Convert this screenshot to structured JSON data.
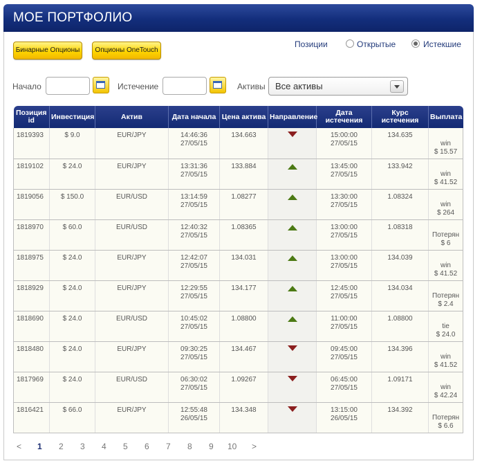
{
  "header": {
    "title": "МОЕ ПОРТФОЛИО"
  },
  "buttons": {
    "binary": "Бинарные Опционы",
    "onetouch": "Опционы OneTouch"
  },
  "positions": {
    "label": "Позиции",
    "open": "Открытые",
    "expired": "Истекшие",
    "selected": "expired"
  },
  "filters": {
    "start_label": "Начало",
    "start_value": "",
    "expiry_label": "Истечение",
    "expiry_value": "",
    "assets_label": "Активы",
    "assets_value": "Все активы"
  },
  "table": {
    "headers": [
      "Позиция id",
      "Инвестиция",
      "Актив",
      "Дата начала",
      "Цена актива",
      "Направление",
      "Дата истечения",
      "Курс истечения",
      "Выплата"
    ],
    "rows": [
      {
        "id": "1819393",
        "inv": "$ 9.0",
        "asset": "EUR/JPY",
        "st": "14:46:36",
        "sd": "27/05/15",
        "price": "134.663",
        "dir": "down",
        "et": "15:00:00",
        "ed": "27/05/15",
        "rate": "134.635",
        "r1": "win",
        "r2": "$ 15.57"
      },
      {
        "id": "1819102",
        "inv": "$ 24.0",
        "asset": "EUR/JPY",
        "st": "13:31:36",
        "sd": "27/05/15",
        "price": "133.884",
        "dir": "up",
        "et": "13:45:00",
        "ed": "27/05/15",
        "rate": "133.942",
        "r1": "win",
        "r2": "$ 41.52"
      },
      {
        "id": "1819056",
        "inv": "$ 150.0",
        "asset": "EUR/USD",
        "st": "13:14:59",
        "sd": "27/05/15",
        "price": "1.08277",
        "dir": "up",
        "et": "13:30:00",
        "ed": "27/05/15",
        "rate": "1.08324",
        "r1": "win",
        "r2": "$ 264"
      },
      {
        "id": "1818970",
        "inv": "$ 60.0",
        "asset": "EUR/USD",
        "st": "12:40:32",
        "sd": "27/05/15",
        "price": "1.08365",
        "dir": "up",
        "et": "13:00:00",
        "ed": "27/05/15",
        "rate": "1.08318",
        "r1": "Потерян",
        "r2": "$ 6"
      },
      {
        "id": "1818975",
        "inv": "$ 24.0",
        "asset": "EUR/JPY",
        "st": "12:42:07",
        "sd": "27/05/15",
        "price": "134.031",
        "dir": "up",
        "et": "13:00:00",
        "ed": "27/05/15",
        "rate": "134.039",
        "r1": "win",
        "r2": "$ 41.52"
      },
      {
        "id": "1818929",
        "inv": "$ 24.0",
        "asset": "EUR/JPY",
        "st": "12:29:55",
        "sd": "27/05/15",
        "price": "134.177",
        "dir": "up",
        "et": "12:45:00",
        "ed": "27/05/15",
        "rate": "134.034",
        "r1": "Потерян",
        "r2": "$ 2.4"
      },
      {
        "id": "1818690",
        "inv": "$ 24.0",
        "asset": "EUR/USD",
        "st": "10:45:02",
        "sd": "27/05/15",
        "price": "1.08800",
        "dir": "up",
        "et": "11:00:00",
        "ed": "27/05/15",
        "rate": "1.08800",
        "r1": "tie",
        "r2": "$ 24.0"
      },
      {
        "id": "1818480",
        "inv": "$ 24.0",
        "asset": "EUR/JPY",
        "st": "09:30:25",
        "sd": "27/05/15",
        "price": "134.467",
        "dir": "down",
        "et": "09:45:00",
        "ed": "27/05/15",
        "rate": "134.396",
        "r1": "win",
        "r2": "$ 41.52"
      },
      {
        "id": "1817969",
        "inv": "$ 24.0",
        "asset": "EUR/USD",
        "st": "06:30:02",
        "sd": "27/05/15",
        "price": "1.09267",
        "dir": "down",
        "et": "06:45:00",
        "ed": "27/05/15",
        "rate": "1.09171",
        "r1": "win",
        "r2": "$ 42.24"
      },
      {
        "id": "1816421",
        "inv": "$ 66.0",
        "asset": "EUR/JPY",
        "st": "12:55:48",
        "sd": "26/05/15",
        "price": "134.348",
        "dir": "down",
        "et": "13:15:00",
        "ed": "26/05/15",
        "rate": "134.392",
        "r1": "Потерян",
        "r2": "$ 6.6"
      }
    ]
  },
  "pagination": {
    "prev": "<",
    "pages": [
      "1",
      "2",
      "3",
      "4",
      "5",
      "6",
      "7",
      "8",
      "9",
      "10"
    ],
    "current": "1",
    "next": ">"
  },
  "icons": {
    "calendar": "calendar-icon",
    "down": "arrow-down-icon",
    "up": "arrow-up-icon"
  },
  "colors": {
    "header": "#132e7c",
    "down": "#8b1f1f",
    "up": "#4c7a14",
    "button": "#ffd600"
  }
}
